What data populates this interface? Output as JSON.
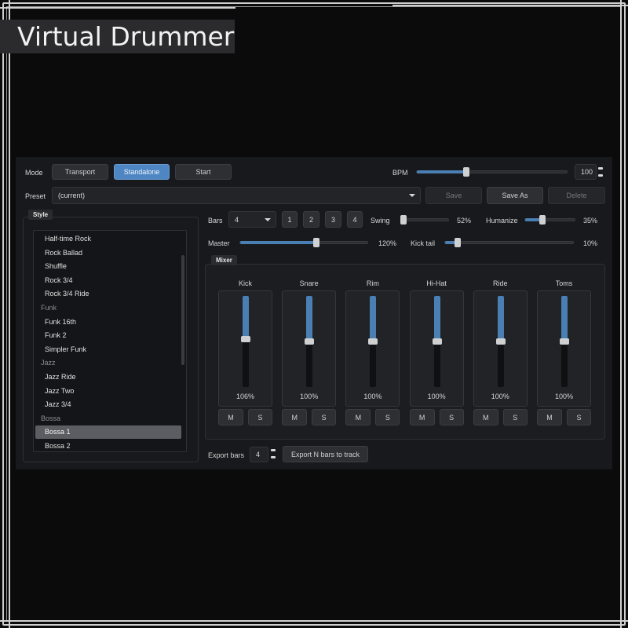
{
  "app": {
    "title": "Virtual Drummer"
  },
  "mode": {
    "label": "Mode",
    "buttons": [
      "Transport",
      "Standalone",
      "Start"
    ],
    "active": "Standalone"
  },
  "bpm": {
    "label": "BPM",
    "value": "100",
    "fraction": 0.33
  },
  "preset": {
    "label": "Preset",
    "value": "(current)",
    "save": "Save",
    "save_as": "Save As",
    "delete": "Delete"
  },
  "style": {
    "title": "Style",
    "rows": [
      {
        "text": "Half-time Rock",
        "kind": "item"
      },
      {
        "text": "Rock Ballad",
        "kind": "item"
      },
      {
        "text": "Shuffle",
        "kind": "item"
      },
      {
        "text": "Rock 3/4",
        "kind": "item"
      },
      {
        "text": "Rock 3/4 Ride",
        "kind": "item"
      },
      {
        "text": "Funk",
        "kind": "cat"
      },
      {
        "text": "Funk 16th",
        "kind": "item"
      },
      {
        "text": "Funk 2",
        "kind": "item"
      },
      {
        "text": "Simpler Funk",
        "kind": "item"
      },
      {
        "text": "Jazz",
        "kind": "cat"
      },
      {
        "text": "Jazz Ride",
        "kind": "item"
      },
      {
        "text": "Jazz Two",
        "kind": "item"
      },
      {
        "text": "Jazz 3/4",
        "kind": "item"
      },
      {
        "text": "Bossa",
        "kind": "cat"
      },
      {
        "text": "Bossa 1",
        "kind": "item",
        "selected": true
      },
      {
        "text": "Bossa 2",
        "kind": "item"
      }
    ]
  },
  "bars": {
    "label": "Bars",
    "value": "4",
    "quick": [
      "1",
      "2",
      "3",
      "4"
    ]
  },
  "swing": {
    "label": "Swing",
    "value": "52%",
    "fraction": 0.05
  },
  "humanize": {
    "label": "Humanize",
    "value": "35%",
    "fraction": 0.35
  },
  "master": {
    "label": "Master",
    "value": "120%",
    "fraction": 0.6
  },
  "kick_tail": {
    "label": "Kick tail",
    "value": "10%",
    "fraction": 0.1
  },
  "mixer": {
    "title": "Mixer",
    "mute_label": "M",
    "solo_label": "S",
    "channels": [
      {
        "name": "Kick",
        "value": "106%",
        "level": 0.53
      },
      {
        "name": "Snare",
        "value": "100%",
        "level": 0.5
      },
      {
        "name": "Rim",
        "value": "100%",
        "level": 0.5
      },
      {
        "name": "Hi-Hat",
        "value": "100%",
        "level": 0.5
      },
      {
        "name": "Ride",
        "value": "100%",
        "level": 0.5
      },
      {
        "name": "Toms",
        "value": "100%",
        "level": 0.5
      }
    ]
  },
  "export": {
    "label": "Export bars",
    "value": "4",
    "button": "Export N bars to track"
  },
  "colors": {
    "accent": "#4e86c4",
    "panel": "#18191c",
    "background": "#0b0b0c"
  }
}
